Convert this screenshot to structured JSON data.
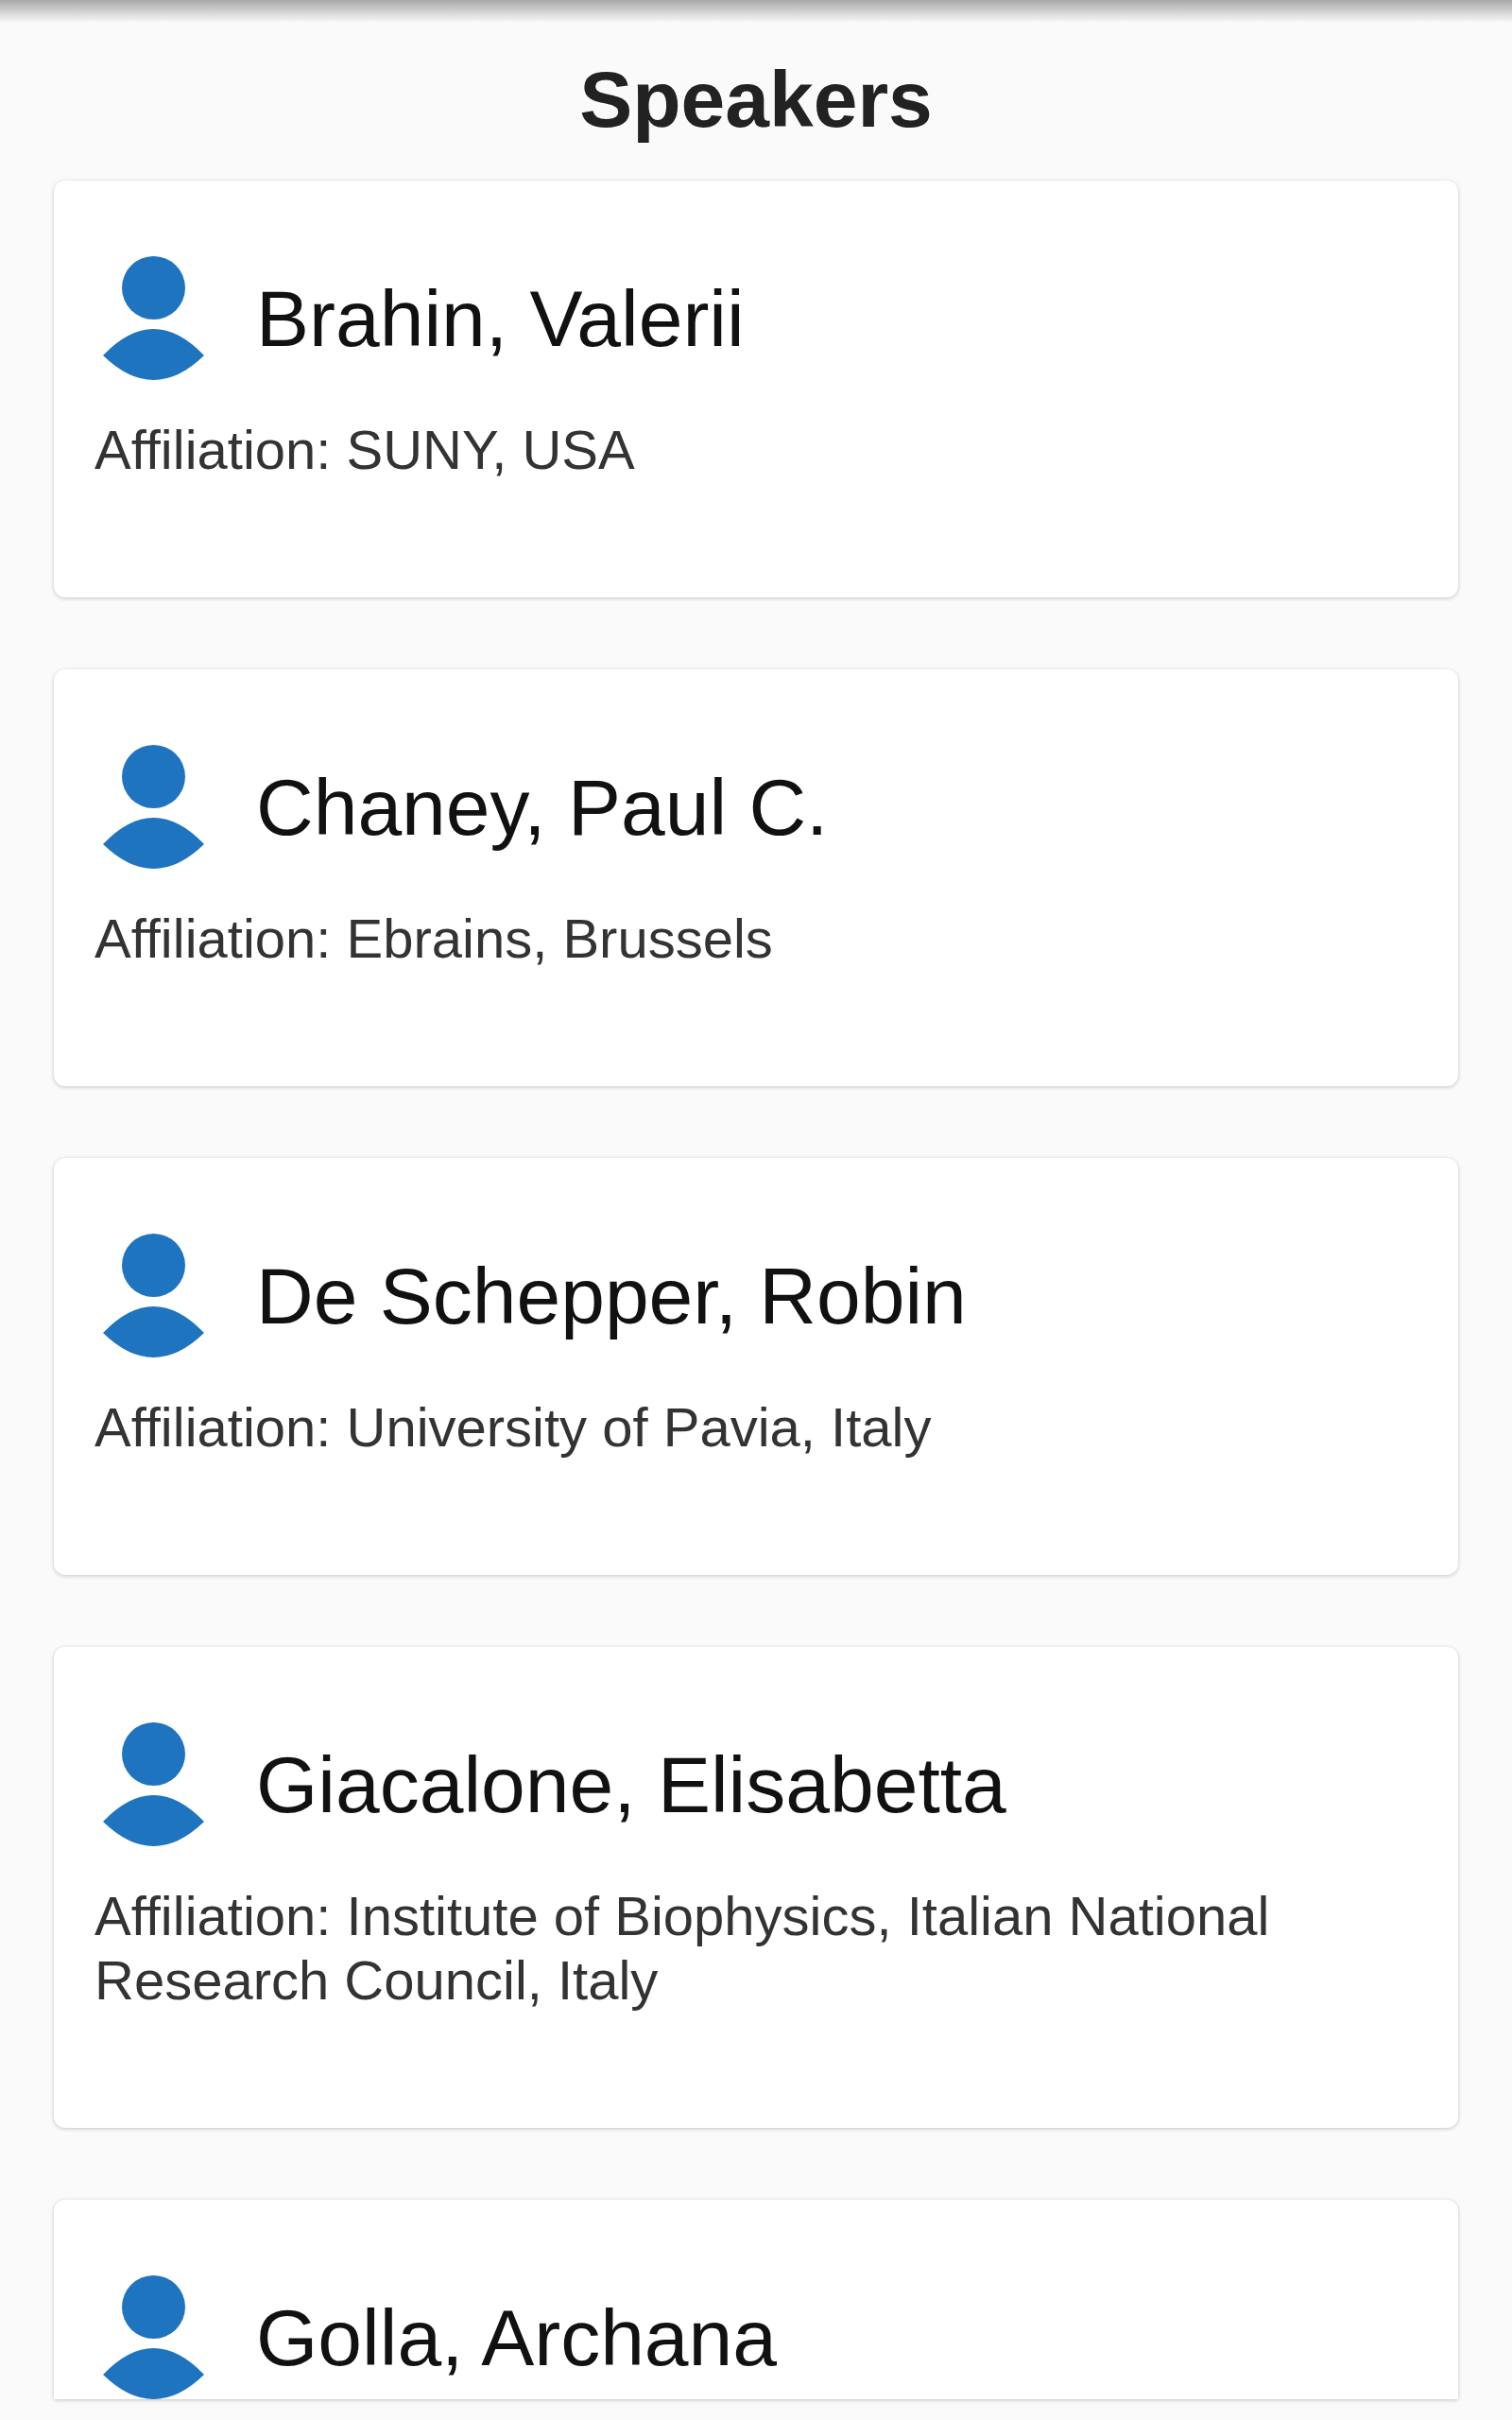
{
  "title": "Speakers",
  "speakers": [
    {
      "name": "Brahin, Valerii",
      "affiliation": "Affiliation: SUNY, USA"
    },
    {
      "name": "Chaney, Paul C.",
      "affiliation": "Affiliation: Ebrains, Brussels"
    },
    {
      "name": "De Schepper, Robin",
      "affiliation": "Affiliation: University of Pavia, Italy"
    },
    {
      "name": "Giacalone, Elisabetta",
      "affiliation": "Affiliation: Institute of Biophysics, Italian National Research Council, Italy"
    },
    {
      "name": "Golla, Archana"
    }
  ]
}
